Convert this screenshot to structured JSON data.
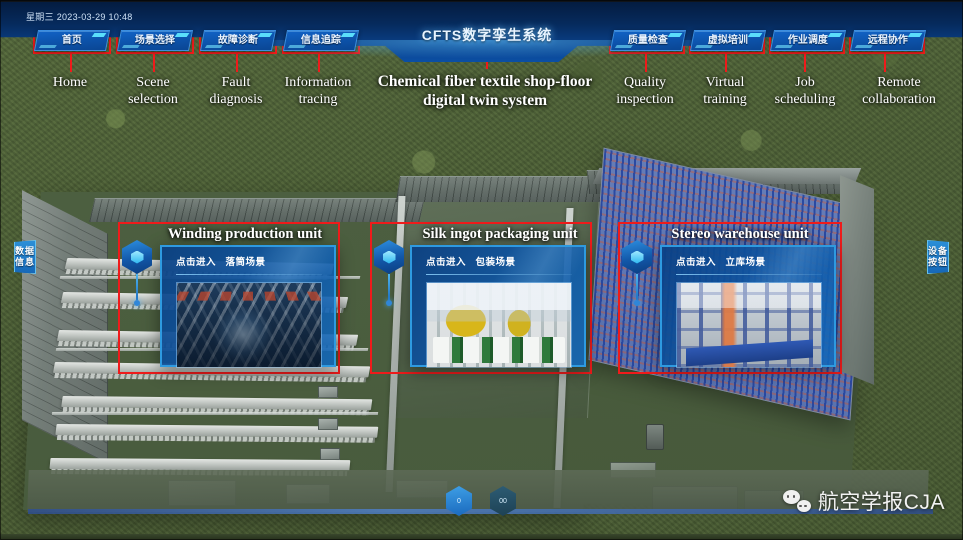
{
  "header": {
    "datetime": "星期三  2023-03-29  10:48",
    "system_title": "CFTS数字孪生系统",
    "main_title": "Chemical fiber textile shop-floor digital twin system",
    "accent_color": "#1263c6",
    "highlight_color": "#ef1b1b",
    "nav_left": [
      {
        "label": "首页",
        "caption": "Home"
      },
      {
        "label": "场景选择",
        "caption": "Scene\nselection"
      },
      {
        "label": "故障诊断",
        "caption": "Fault\ndiagnosis"
      },
      {
        "label": "信息追踪",
        "caption": "Information\ntracing"
      }
    ],
    "nav_right": [
      {
        "label": "质量检查",
        "caption": "Quality\ninspection"
      },
      {
        "label": "虚拟培训",
        "caption": "Virtual\ntraining"
      },
      {
        "label": "作业调度",
        "caption": "Job\nscheduling"
      },
      {
        "label": "远程协作",
        "caption": "Remote\ncollaboration"
      }
    ]
  },
  "side_tabs": {
    "left": "数据信息",
    "right": "设备按钮"
  },
  "panels": [
    {
      "title": "Winding production unit",
      "prompt": "点击进入",
      "scene": "落筒场景",
      "icon": "layered-cube-icon"
    },
    {
      "title": "Silk ingot packaging unit",
      "prompt": "点击进入",
      "scene": "包装场景",
      "icon": "layered-cube-icon"
    },
    {
      "title": "Stereo warehouse unit",
      "prompt": "点击进入",
      "scene": "立库场景",
      "icon": "layered-cube-icon"
    }
  ],
  "badges": [
    {
      "label": "0"
    },
    {
      "label": "00"
    }
  ],
  "watermark": {
    "text": "航空学报CJA",
    "icon": "wechat-icon"
  }
}
